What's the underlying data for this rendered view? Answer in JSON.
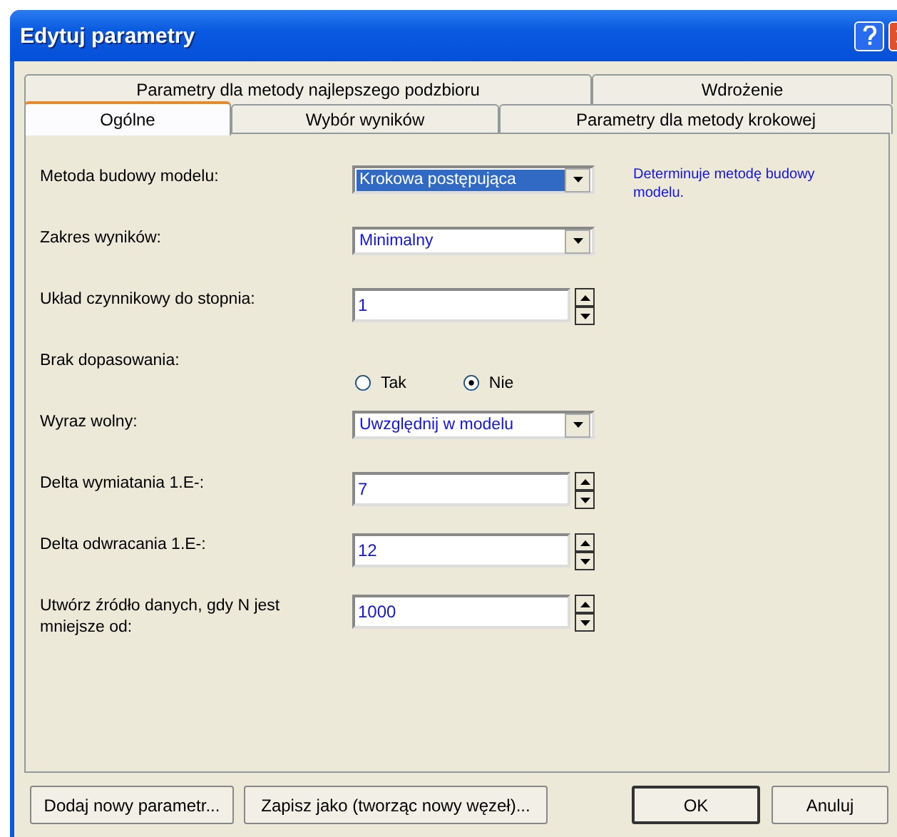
{
  "window": {
    "title": "Edytuj parametry"
  },
  "tab_rows": [
    [
      {
        "label": "Parametry dla metody najlepszego podzbioru",
        "selected": false
      },
      {
        "label": "Wdrożenie",
        "selected": false
      }
    ],
    [
      {
        "label": "Ogólne",
        "selected": true
      },
      {
        "label": "Wybór wyników",
        "selected": false
      },
      {
        "label": "Parametry dla metody krokowej",
        "selected": false
      }
    ]
  ],
  "fields": [
    {
      "kind": "dropdown",
      "label": "Metoda budowy modelu:",
      "value": "Krokowa postępująca",
      "highlighted": true,
      "help": "Determinuje metodę budowy modelu."
    },
    {
      "kind": "dropdown",
      "label": "Zakres wyników:",
      "value": "Minimalny",
      "highlighted": false
    },
    {
      "kind": "spin",
      "label": "Układ czynnikowy do stopnia:",
      "value": "1"
    },
    {
      "kind": "radio",
      "label": "Brak dopasowania:",
      "options": [
        {
          "label": "Tak",
          "selected": false
        },
        {
          "label": "Nie",
          "selected": true
        }
      ]
    },
    {
      "kind": "dropdown",
      "label": "Wyraz wolny:",
      "value": "Uwzględnij w modelu",
      "highlighted": false
    },
    {
      "kind": "spin",
      "label": "Delta wymiatania 1.E-:",
      "value": "7"
    },
    {
      "kind": "spin",
      "label": "Delta odwracania 1.E-:",
      "value": "12"
    },
    {
      "kind": "spin",
      "label": "Utwórz źródło danych, gdy N jest mniejsze od:",
      "value": "1000"
    }
  ],
  "buttons": [
    {
      "label": "Dodaj nowy parametr...",
      "default": false
    },
    {
      "label": "Zapisz jako (tworząc nowy węzeł)...",
      "default": false
    },
    {
      "label": "OK",
      "default": true
    },
    {
      "label": "Anuluj",
      "default": false
    }
  ]
}
